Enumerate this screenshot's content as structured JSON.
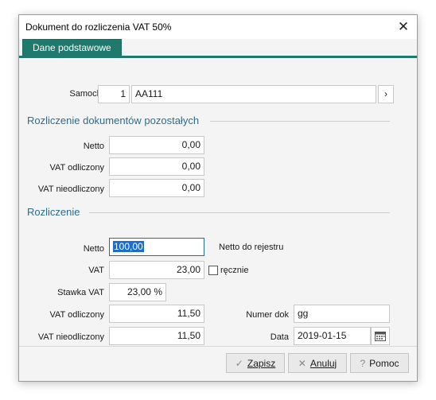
{
  "window": {
    "title": "Dokument do rozliczenia VAT 50%"
  },
  "tabs": [
    {
      "label": "Dane podstawowe"
    }
  ],
  "car": {
    "label": "Samochód",
    "number": "1",
    "value": "AA111"
  },
  "section1": {
    "title": "Rozliczenie dokumentów pozostałych",
    "netto_label": "Netto",
    "netto_value": "0,00",
    "vat_odl_label": "VAT odliczony",
    "vat_odl_value": "0,00",
    "vat_nieodl_label": "VAT nieodliczony",
    "vat_nieodl_value": "0,00"
  },
  "section2": {
    "title": "Rozliczenie",
    "netto_label": "Netto",
    "netto_value": "100,00",
    "netto_reg_label": "Netto do rejestru",
    "vat_label": "VAT",
    "vat_value": "23,00",
    "manual_label": "ręcznie",
    "manual_checked": false,
    "stawka_label": "Stawka VAT",
    "stawka_value": "23,00 %",
    "vat_odl_label": "VAT odliczony",
    "vat_odl_value": "11,50",
    "vat_nieodl_label": "VAT nieodliczony",
    "vat_nieodl_value": "11,50",
    "numer_label": "Numer dok",
    "numer_value": "gg",
    "data_label": "Data",
    "data_value": "2019-01-15"
  },
  "footer": {
    "save_icon": "check-icon",
    "save_label": "Zapisz",
    "cancel_icon": "x-icon",
    "cancel_label": "Anuluj",
    "help_icon": "question-icon",
    "help_label": "Pomoc"
  },
  "colors": {
    "accent": "#1e7a6c",
    "section_title": "#2b6d8f",
    "selection": "#1b6ed1"
  }
}
